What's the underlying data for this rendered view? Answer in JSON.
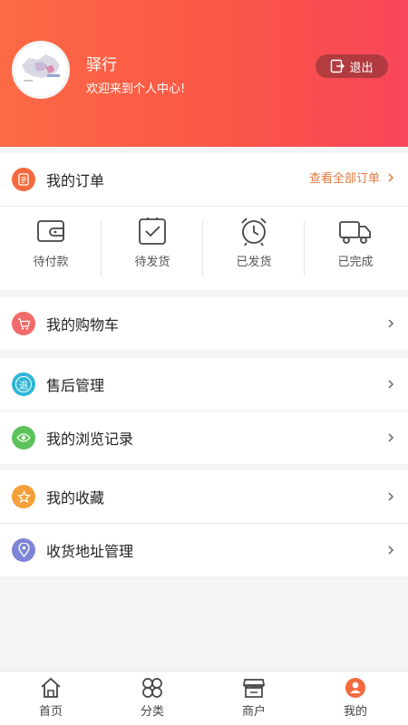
{
  "profile": {
    "name": "驿行",
    "welcome": "欢迎来到个人中心!",
    "logout_label": "退出"
  },
  "orders": {
    "title": "我的订单",
    "view_all": "查看全部订单",
    "statuses": [
      {
        "label": "待付款",
        "icon": "wallet-icon"
      },
      {
        "label": "待发货",
        "icon": "checkbox-icon"
      },
      {
        "label": "已发货",
        "icon": "alarm-clock-icon"
      },
      {
        "label": "已完成",
        "icon": "truck-icon"
      }
    ]
  },
  "menu": {
    "cart": "我的购物车",
    "aftersale": "售后管理",
    "aftersale_icon_char": "退",
    "history": "我的浏览记录",
    "favorites": "我的收藏",
    "address": "收货地址管理"
  },
  "tabbar": {
    "items": [
      {
        "label": "首页",
        "icon": "home-icon"
      },
      {
        "label": "分类",
        "icon": "category-icon"
      },
      {
        "label": "商户",
        "icon": "store-icon"
      },
      {
        "label": "我的",
        "icon": "user-icon",
        "active": true
      }
    ]
  },
  "colors": {
    "header_start": "#fc6a45",
    "header_end": "#f7465a",
    "accent_link": "#e27a3f",
    "orders_icon": "#f26a3e",
    "cart_icon": "#f26b6b",
    "aftersale_icon": "#30b5d6",
    "history_icon": "#5cc35a",
    "favorites_icon": "#f5a03a",
    "address_icon": "#7d84d6",
    "tab_active": "#f26a3e"
  }
}
